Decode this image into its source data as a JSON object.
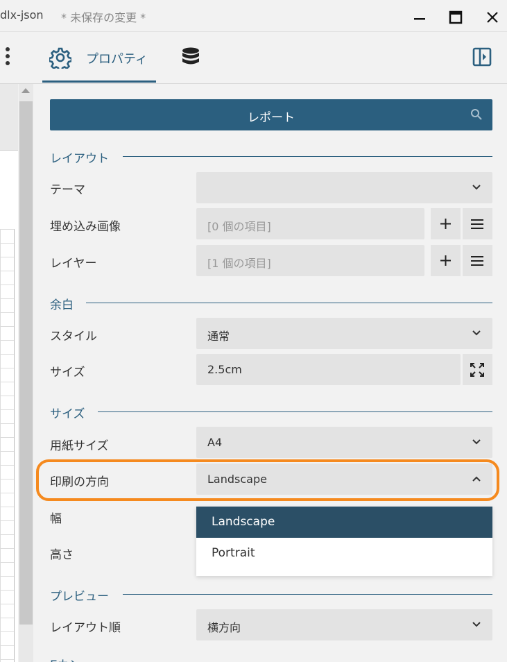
{
  "window": {
    "app_title": "dlx-json",
    "unsaved": "* 未保存の変更 *"
  },
  "tabs": {
    "properties_label": "プロパティ"
  },
  "panel": {
    "report_button": "レポート",
    "sections": {
      "layout": "レイアウト",
      "margin": "余白",
      "size": "サイズ",
      "preview": "プレビュー"
    },
    "props": {
      "theme": {
        "label": "テーマ",
        "value": ""
      },
      "embedded_images": {
        "label": "埋め込み画像",
        "value": "[0 個の項目]"
      },
      "layers": {
        "label": "レイヤー",
        "value": "[1 個の項目]"
      },
      "style": {
        "label": "スタイル",
        "value": "通常"
      },
      "margin_size": {
        "label": "サイズ",
        "value": "2.5cm"
      },
      "paper_size": {
        "label": "用紙サイズ",
        "value": "A4"
      },
      "orientation": {
        "label": "印刷の方向",
        "value": "Landscape"
      },
      "width": {
        "label": "幅"
      },
      "height": {
        "label": "高さ"
      },
      "layout_order": {
        "label": "レイアウト順",
        "value": "横方向"
      },
      "next_partial": {
        "label": "Eカン..."
      }
    },
    "orientation_options": [
      "Landscape",
      "Portrait"
    ]
  },
  "colors": {
    "accent": "#2b5f7f",
    "highlight": "#f58a1f",
    "selected_option": "#2b4f66"
  }
}
